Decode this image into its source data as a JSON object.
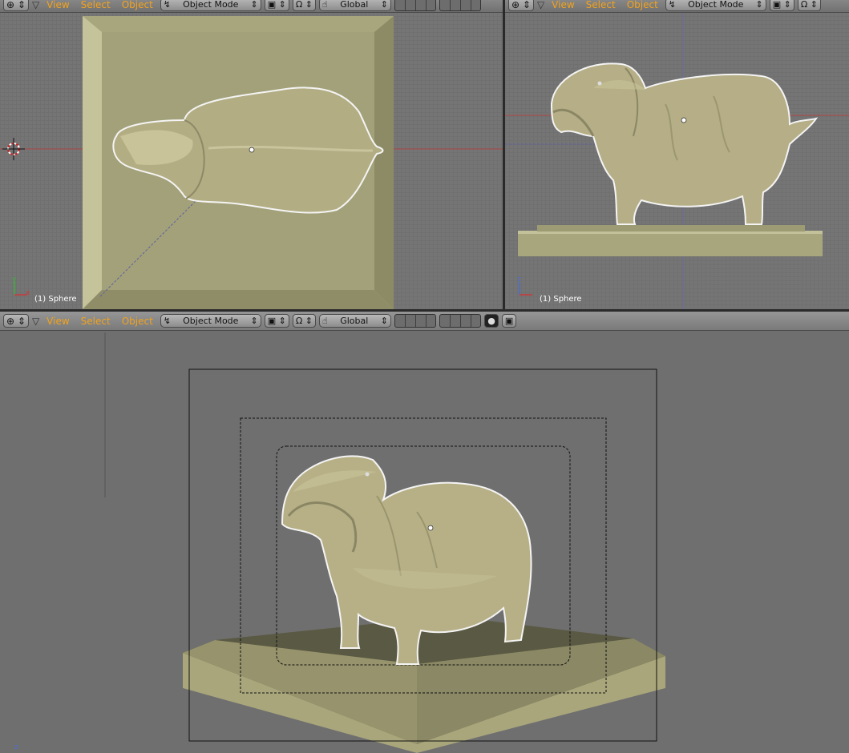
{
  "header": {
    "menus": [
      "View",
      "Select",
      "Object"
    ],
    "mode": "Object Mode",
    "orientation": "Global"
  },
  "viewports": {
    "top": {
      "object_label": "(1) Sphere",
      "axis_x": "x",
      "axis_y": "y"
    },
    "right": {
      "object_label": "(1) Sphere",
      "axis_y": "z"
    },
    "camera": {
      "axis_z": "z"
    }
  },
  "colors": {
    "menu_text": "#f2a21c",
    "model": "#b9b388",
    "base": "#a8a67c",
    "viewport_bg": "#757575",
    "grid_line": "#6a6a6a"
  },
  "icons": [
    "viewport-type-icon",
    "menu-collapse-icon",
    "mode-icon",
    "shading-icon",
    "pivot-icon",
    "manipulator-icon",
    "layer-grid-icon",
    "lock-icon",
    "render-icon"
  ]
}
